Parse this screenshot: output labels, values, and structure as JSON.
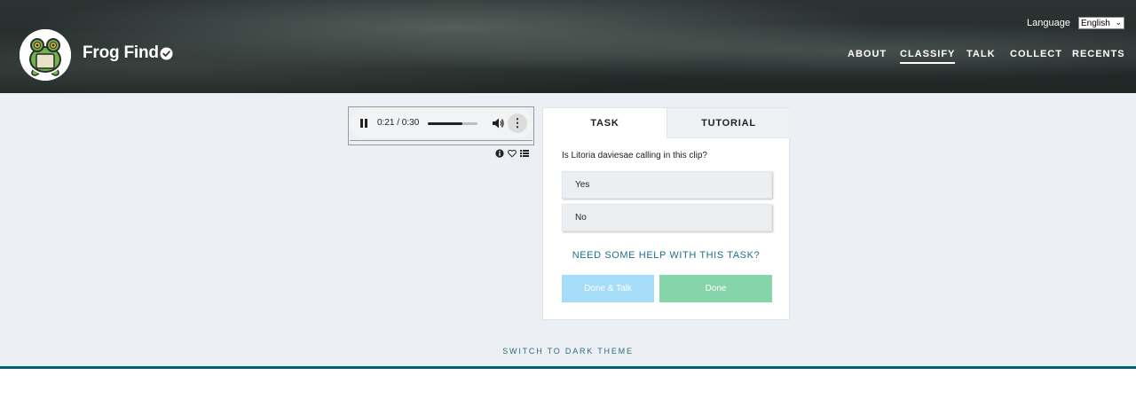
{
  "header": {
    "project_title": "Frog Find",
    "language_label": "Language",
    "language_selected": "English",
    "nav": [
      {
        "label": "ABOUT"
      },
      {
        "label": "CLASSIFY",
        "active": true
      },
      {
        "label": "TALK"
      },
      {
        "label": "COLLECT"
      },
      {
        "label": "RECENTS"
      }
    ]
  },
  "audio": {
    "time": "0:21 / 0:30",
    "progress_fraction": 0.7
  },
  "task": {
    "tabs": [
      {
        "label": "TASK"
      },
      {
        "label": "TUTORIAL"
      }
    ],
    "question": "Is Litoria daviesae calling in this clip?",
    "answers": [
      "Yes",
      "No"
    ],
    "help_link": "NEED SOME HELP WITH THIS TASK?",
    "done_talk_label": "Done & Talk",
    "done_label": "Done"
  },
  "footer": {
    "theme_switch": "SWITCH TO DARK THEME"
  },
  "colors": {
    "accent_teal": "#00626b",
    "done_green": "#86d4a9",
    "done_talk_blue": "#a5ddf8"
  }
}
